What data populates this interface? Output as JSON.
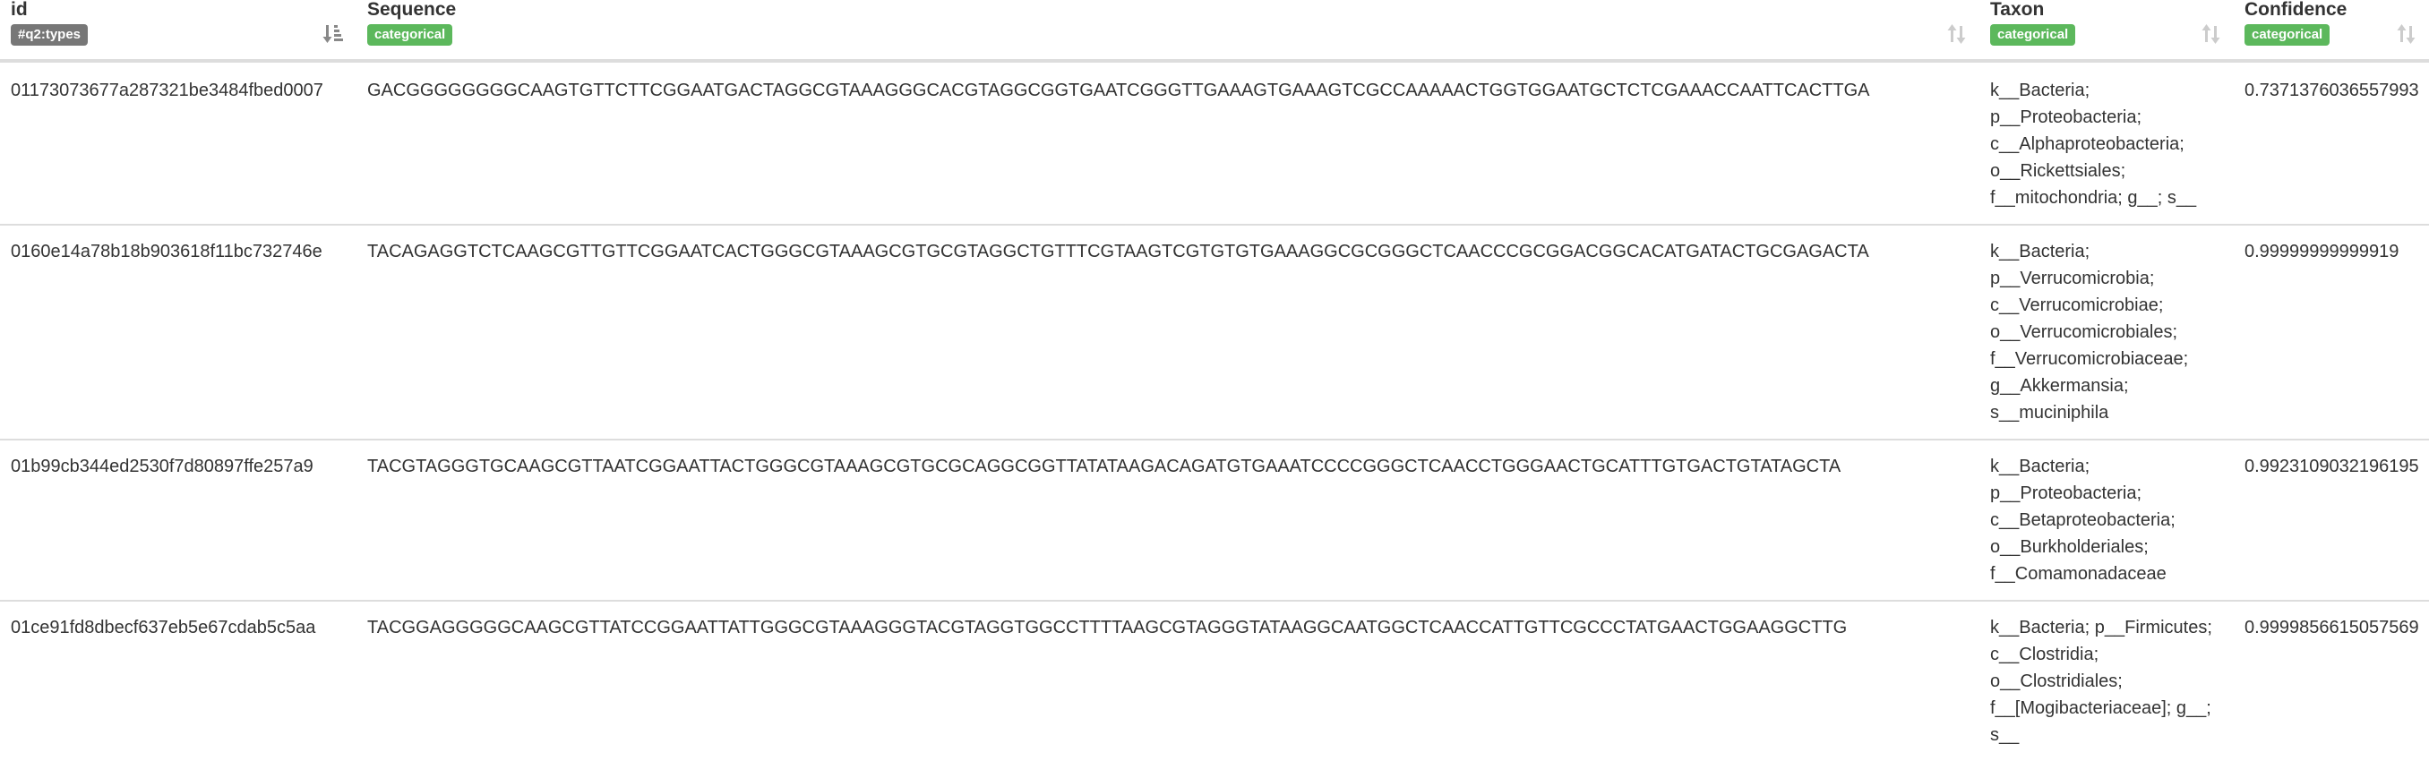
{
  "table": {
    "columns": [
      {
        "title": "id",
        "badge": "#q2:types",
        "badge_color": "#777777"
      },
      {
        "title": "Sequence",
        "badge": "categorical",
        "badge_color": "#5cb85c"
      },
      {
        "title": "Taxon",
        "badge": "categorical",
        "badge_color": "#5cb85c"
      },
      {
        "title": "Confidence",
        "badge": "categorical",
        "badge_color": "#5cb85c"
      }
    ],
    "rows": [
      {
        "id": "01173073677a287321be3484fbed0007",
        "sequence": "GACGGGGGGGGCAAGTGTTCTTCGGAATGACTAGGCGTAAAGGGCACGTAGGCGGTGAATCGGGTTGAAAGTGAAAGTCGCCAAAAACTGGTGGAATGCTCTCGAAACCAATTCACTTGA",
        "taxon": "k__Bacteria; p__Proteobacteria; c__Alphaproteobacteria; o__Rickettsiales; f__mitochondria; g__; s__",
        "confidence": "0.7371376036557993"
      },
      {
        "id": "0160e14a78b18b903618f11bc732746e",
        "sequence": "TACAGAGGTCTCAAGCGTTGTTCGGAATCACTGGGCGTAAAGCGTGCGTAGGCTGTTTCGTAAGTCGTGTGTGAAAGGCGCGGGCTCAACCCGCGGACGGCACATGATACTGCGAGACTA",
        "taxon": "k__Bacteria; p__Verrucomicrobia; c__Verrucomicrobiae; o__Verrucomicrobiales; f__Verrucomicrobiaceae; g__Akkermansia; s__muciniphila",
        "confidence": "0.99999999999919"
      },
      {
        "id": "01b99cb344ed2530f7d80897ffe257a9",
        "sequence": "TACGTAGGGTGCAAGCGTTAATCGGAATTACTGGGCGTAAAGCGTGCGCAGGCGGTTATATAAGACAGATGTGAAATCCCCGGGCTCAACCTGGGAACTGCATTTGTGACTGTATAGCTA",
        "taxon": "k__Bacteria; p__Proteobacteria; c__Betaproteobacteria; o__Burkholderiales; f__Comamonadaceae",
        "confidence": "0.9923109032196195"
      },
      {
        "id": "01ce91fd8dbecf637eb5e67cdab5c5aa",
        "sequence": "TACGGAGGGGGCAAGCGTTATCCGGAATTATTGGGCGTAAAGGGTACGTAGGTGGCCTTTTAAGCGTAGGGTATAAGGCAATGGCTCAACCATTGTTCGCCCTATGAACTGGAAGGCTTG",
        "taxon": "k__Bacteria; p__Firmicutes; c__Clostridia; o__Clostridiales; f__[Mogibacteriaceae]; g__; s__",
        "confidence": "0.9999856615057569"
      }
    ]
  },
  "icons": {
    "sort_active": "sort-amount-down-icon",
    "sort_inactive": "sort-icon"
  }
}
